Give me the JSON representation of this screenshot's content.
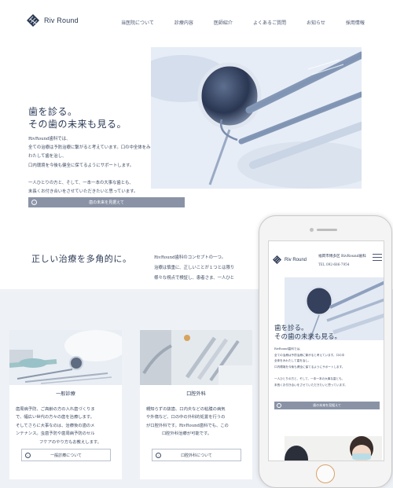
{
  "brand": {
    "name": "Riv Round"
  },
  "nav": [
    "当医院について",
    "診療内容",
    "医師紹介",
    "よくあるご質問",
    "お知らせ",
    "採用情報"
  ],
  "hero": {
    "title_lines": [
      "歯を診る。",
      "その歯の未来も見る。"
    ],
    "text_lines": [
      "RivRound歯科では、",
      "全ての治療は予防治療に繋がると考えています。口の中全体をみ",
      "わたして歯を治し、",
      "口内環境を今後も健全に保てるようにサポートします。",
      "",
      "一人ひとりの方と、そして、一本一本の大事な歯とも、",
      "末長くお付き合いをさせていただきたいと思っています。"
    ],
    "button_label": "歯の未来を見据えて"
  },
  "concept": {
    "title": "正しい治療を多角的に。",
    "text_lines": [
      "RivRound歯科のコンセプトの一つ。",
      "治療は慎重に、正しいことが１つとは限り",
      "様々な視点で検証し、患者さま、一人ひと"
    ]
  },
  "cards": [
    {
      "title": "一般診療",
      "text_lines": [
        "歯周病予防、ご高齢の方の入れ歯づくりま",
        "で、幅広い世代の方々の歯を治療します。",
        "そしてさらに大事なのは、治療後の歯のメ",
        "ンテナンス。虫歯予防や歯周病予防のセル",
        "フケアのやり方もお教えします。"
      ],
      "button_label": "一般診療について"
    },
    {
      "title": "口腔外科",
      "text_lines": [
        "親知らずの抜歯、口内炎などの粘膜の病気",
        "や外傷など、口の中の外科的処置を行うの",
        "が口腔外科です。RivRound歯科でも、この",
        "口腔外科治療が可能です。"
      ],
      "button_label": "口腔外科について"
    }
  ],
  "phone": {
    "address": "福岡市博多区 RivRound歯科",
    "tel": "TEL 092-686-7954",
    "title_lines": [
      "歯を診る。",
      "その歯の未来も見る。"
    ],
    "text_lines": [
      "RivRound歯科では、",
      "全ての治療は予防治療に繋がると考えています。口の中",
      "全体をみわたして歯を治し、",
      "口内環境を今後も健全に保てるようにサポートします。",
      "",
      "一人ひとりの方と、そして、一本一本の大事な歯とも、",
      "末長くお付き合いをさせていただきたいと思っています。"
    ],
    "button_label": "歯の未来を見据えて"
  }
}
